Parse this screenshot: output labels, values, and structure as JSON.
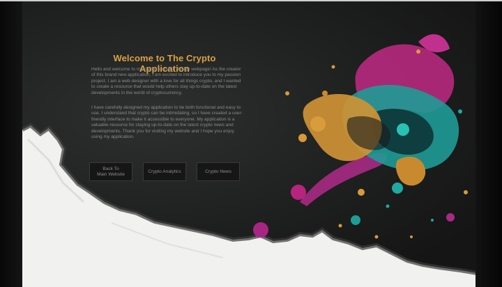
{
  "hero": {
    "title": "Welcome to The Crypto Application",
    "paragraph1": "Hello and welcome to my crypto and web design webpage! As the creator of this brand new application, I am excited to introduce you to my passion project. I am a web designer with a love for all things crypto, and I wanted to create a resource that would help others stay up-to-date on the latest developments in the world of cryptocurrency.",
    "paragraph2": "I have carefully designed my application to be both functional and easy to use. I understand that crypto can be intimidating, so I have created a user-friendly interface to make it accessible to everyone. My application is a valuable resource for staying up-to-date on the latest crypto news and developments. Thank you for visiting my website and I hope you enjoy using my application."
  },
  "nav": {
    "back_label": "Back To\nMain Website",
    "analytics_label": "Crypto Analytics",
    "news_label": "Crypto News"
  },
  "colors": {
    "title": "#d9a340",
    "background": "#1e1f1f",
    "paint_white": "#f2f2f0",
    "splash_magenta": "#c02a8f",
    "splash_teal": "#1fa8a0",
    "splash_orange": "#d89a3a"
  }
}
